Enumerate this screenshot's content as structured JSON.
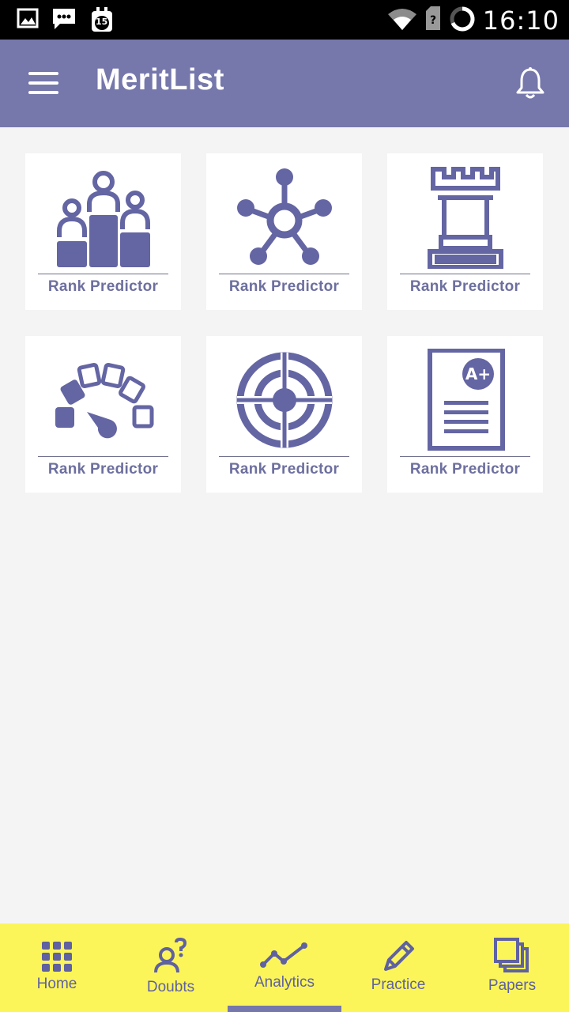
{
  "status_bar": {
    "time": "16:10",
    "notification_badge": "15",
    "icons": [
      "image-icon",
      "message-icon",
      "calendar-icon",
      "wifi-icon",
      "sim-icon",
      "battery-ring-icon"
    ]
  },
  "app_bar": {
    "title": "MeritList",
    "menu_icon": "hamburger-menu-icon",
    "action_icon": "bell-icon"
  },
  "colors": {
    "app_bar": "#7678ab",
    "icon": "#6465a3",
    "bottom_nav": "#fbf55a",
    "nav_text": "#5f61a0",
    "background": "#f4f4f4"
  },
  "cards": [
    {
      "label": "Rank Predictor",
      "icon": "podium-people-icon"
    },
    {
      "label": "Rank Predictor",
      "icon": "network-hub-icon"
    },
    {
      "label": "Rank Predictor",
      "icon": "chess-rook-icon"
    },
    {
      "label": "Rank Predictor",
      "icon": "speedometer-gauge-icon"
    },
    {
      "label": "Rank Predictor",
      "icon": "target-crosshair-icon"
    },
    {
      "label": "Rank Predictor",
      "icon": "grade-a-plus-report-icon"
    }
  ],
  "bottom_nav": {
    "active": "Analytics",
    "items": [
      {
        "label": "Home",
        "icon": "grid-dots-icon"
      },
      {
        "label": "Doubts",
        "icon": "person-question-icon"
      },
      {
        "label": "Analytics",
        "icon": "line-chart-icon"
      },
      {
        "label": "Practice",
        "icon": "pencil-icon"
      },
      {
        "label": "Papers",
        "icon": "stacked-papers-icon"
      }
    ]
  }
}
